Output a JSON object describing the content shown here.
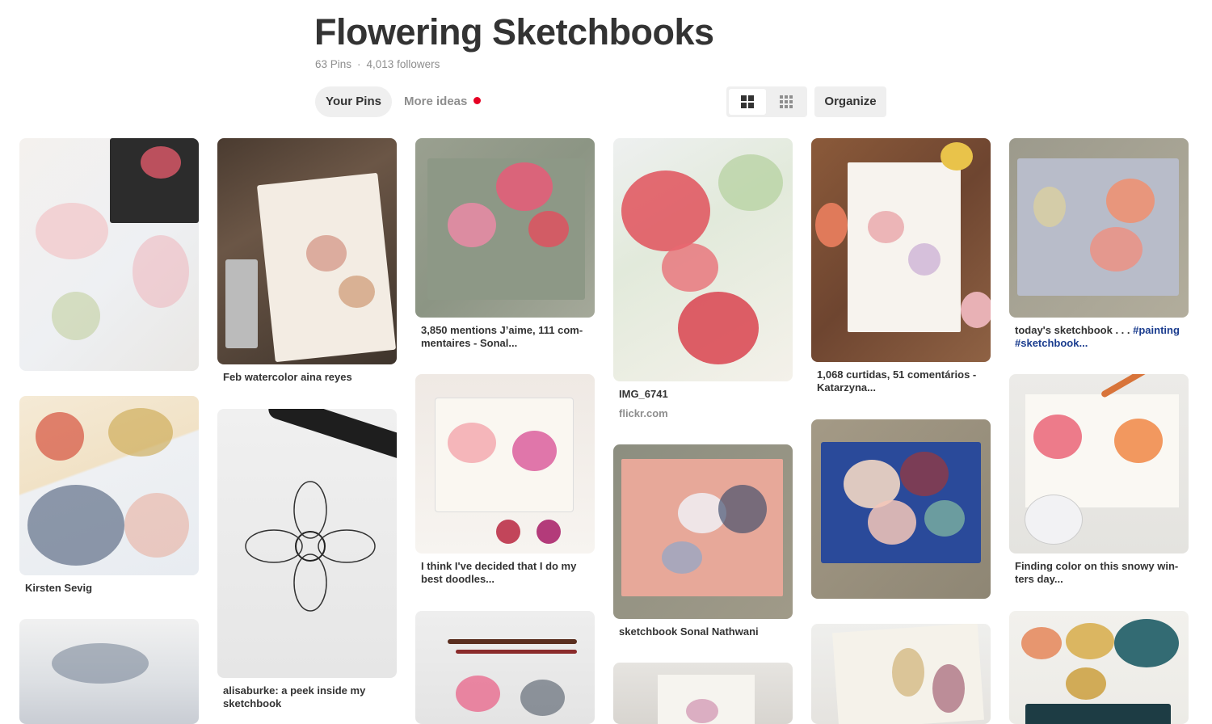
{
  "board": {
    "title": "Flowering Sketchbooks",
    "pins_count": "63 Pins",
    "dot": "·",
    "followers": "4,013 followers"
  },
  "tabs": {
    "your_pins": "Your Pins",
    "more_ideas": "More ideas"
  },
  "toolbar": {
    "organize": "Organize"
  },
  "colors": {
    "accent_red": "#e60023",
    "hashtag_blue": "#1a3c8e"
  },
  "pins": [
    {
      "description": ""
    },
    {
      "description": "Kirsten Sevig"
    },
    {
      "description": ""
    },
    {
      "description": "Feb watercolor aina reyes"
    },
    {
      "description": "alisaburke: a peek inside my sketchbook"
    },
    {
      "description": "3,850 mentions J’aime, 111 com-mentaires - Sonal..."
    },
    {
      "description": "I think I've decided that I do my best doodles..."
    },
    {
      "description": ""
    },
    {
      "description": "IMG_6741",
      "source": "flickr.com"
    },
    {
      "description": "sketchbook Sonal Nathwani"
    },
    {
      "description": ""
    },
    {
      "description": "1,068 curtidas, 51 comentários - Katarzyna..."
    },
    {
      "description": ""
    },
    {
      "description": ""
    },
    {
      "description_plain": "today's sketchbook . . . ",
      "hashtag1": "#painting",
      "hashtag2": "#sketchbook..."
    },
    {
      "description": "Finding color on this snowy win-ters day..."
    },
    {
      "description": ""
    }
  ]
}
